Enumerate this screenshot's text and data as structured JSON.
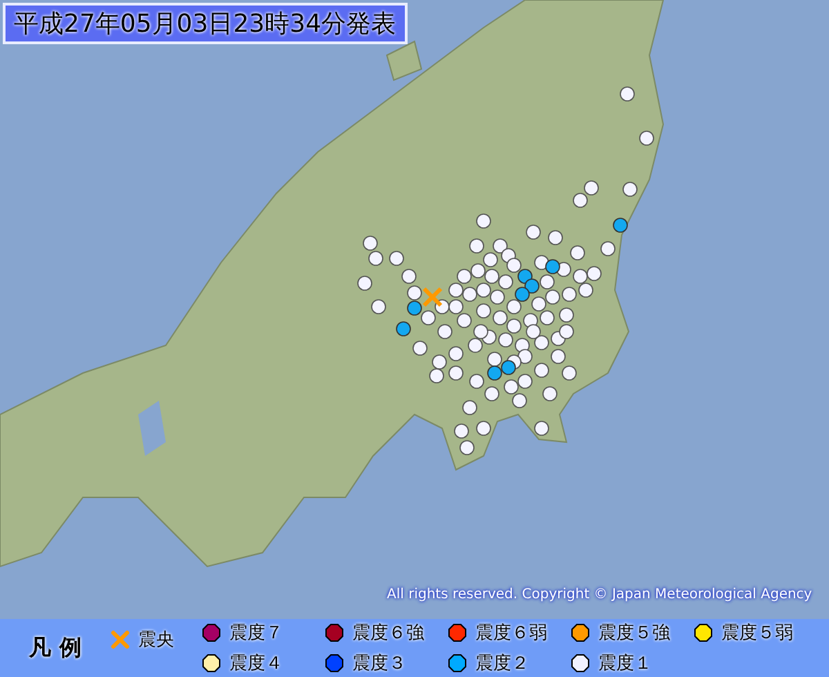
{
  "title": "平成27年05月03日23時34分発表",
  "copyright": "All rights reserved. Copyright © Japan Meteorological Agency",
  "legend": {
    "heading": "凡 例",
    "items": [
      {
        "kind": "epicenter",
        "label": "震央",
        "color": "#ff9900"
      },
      {
        "kind": "dot",
        "label": "震度７",
        "color": "#a50064"
      },
      {
        "kind": "dot",
        "label": "震度６強",
        "color": "#a50021"
      },
      {
        "kind": "dot",
        "label": "震度６弱",
        "color": "#ff2800"
      },
      {
        "kind": "dot",
        "label": "震度５強",
        "color": "#ff9900"
      },
      {
        "kind": "dot",
        "label": "震度５弱",
        "color": "#ffe600"
      },
      {
        "kind": "dot",
        "label": "震度４",
        "color": "#fff0aa"
      },
      {
        "kind": "dot",
        "label": "震度３",
        "color": "#0041ff"
      },
      {
        "kind": "dot",
        "label": "震度２",
        "color": "#00aaff"
      },
      {
        "kind": "dot",
        "label": "震度１",
        "color": "#f2f2ff"
      }
    ]
  }
}
